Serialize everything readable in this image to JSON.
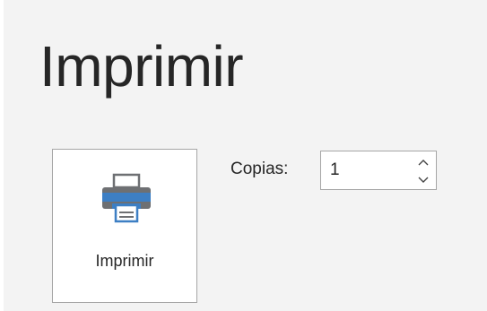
{
  "page": {
    "title": "Imprimir"
  },
  "print_button": {
    "label": "Imprimir",
    "icon": "printer-icon"
  },
  "copies": {
    "label": "Copias:",
    "value": "1",
    "spinner_up_icon": "chevron-up-icon",
    "spinner_down_icon": "chevron-down-icon"
  },
  "colors": {
    "background": "#f3f3f3",
    "text": "#262626",
    "border": "#a6a6a6",
    "printer_blue": "#3d7fc4",
    "printer_gray": "#6e7073"
  }
}
